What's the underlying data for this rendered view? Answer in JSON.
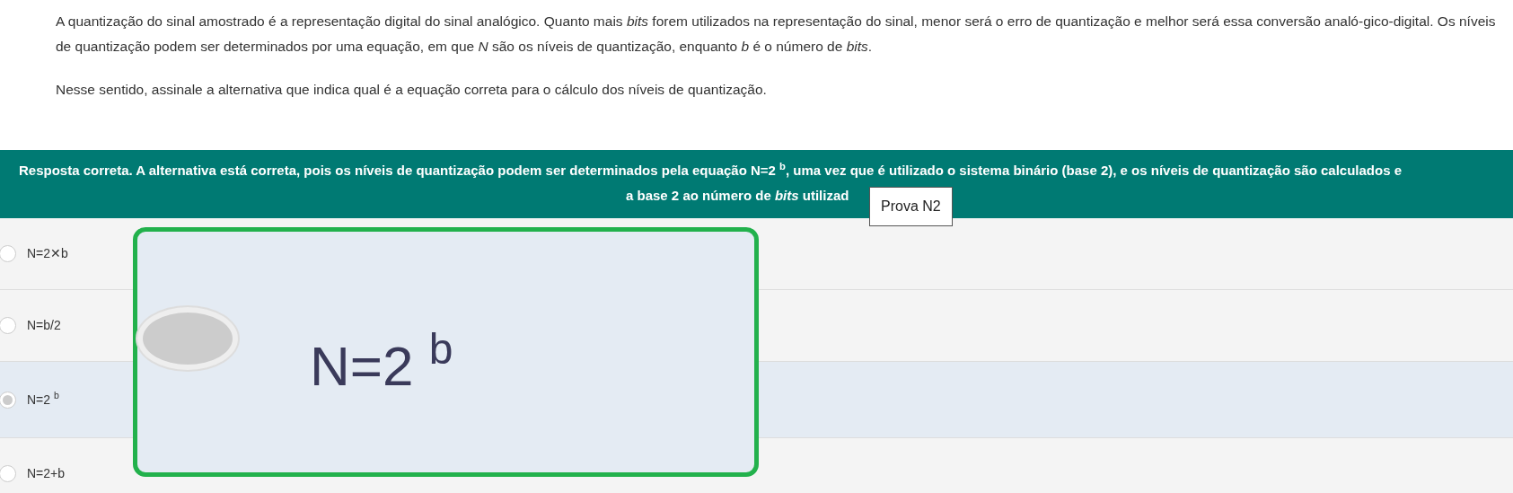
{
  "question": {
    "paragraphs": [
      "A quantização do sinal amostrado é a representação digital do sinal analógico. Quanto mais *bits* forem utilizados na representação do sinal, menor será o erro de quantização e melhor será essa conversão analó-gico-digital. Os níveis de quantização podem ser determinados por uma equação, em que *N* são os níveis de quantização, enquanto *b* é o número de *bits*.",
      "Nesse sentido, assinale a alternativa que indica qual é a equação correta para o cálculo dos níveis de quantização."
    ]
  },
  "feedback": {
    "lines": [
      "Resposta correta. A alternativa está correta, pois os níveis de quantização podem ser determinados pela equação N=2 $^{b}$, uma vez que é utilizado o sistema binário (base 2), e os níveis de quantização são calculados e",
      "a base 2 ao número de *bits* utilizad"
    ]
  },
  "tooltip": "Prova N2",
  "options": [
    {
      "label": "N=2✕b",
      "selected": false
    },
    {
      "label": "N=b/2",
      "selected": false
    },
    {
      "label": "N=2 $^{b}$",
      "selected": true
    },
    {
      "label": "N=2+b",
      "selected": false
    }
  ],
  "magnifier": {
    "label": "N=2 $^{b}$",
    "selected": true
  }
}
